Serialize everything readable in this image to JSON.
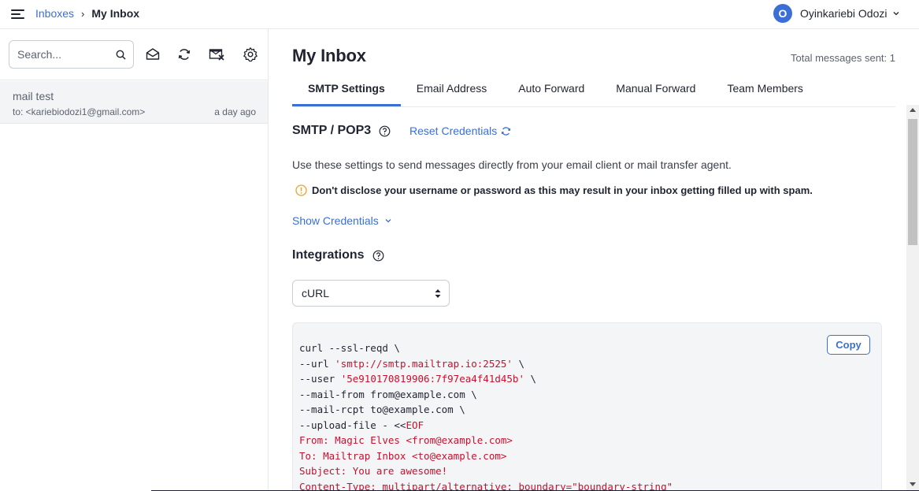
{
  "breadcrumb": {
    "parent": "Inboxes",
    "separator": "›",
    "current": "My Inbox"
  },
  "user": {
    "initial": "O",
    "name": "Oyinkariebi Odozi"
  },
  "sidebar": {
    "search_placeholder": "Search...",
    "toolbar_icons": [
      "mark-read-icon",
      "refresh-icon",
      "clear-inbox-icon",
      "settings-icon"
    ],
    "messages": [
      {
        "subject": "mail test",
        "to": "to: <kariebiodozi1@gmail.com>",
        "time": "a day ago"
      }
    ]
  },
  "main": {
    "title": "My Inbox",
    "total_sent": "Total messages sent: 1",
    "tabs": [
      {
        "label": "SMTP Settings",
        "active": true
      },
      {
        "label": "Email Address",
        "active": false
      },
      {
        "label": "Auto Forward",
        "active": false
      },
      {
        "label": "Manual Forward",
        "active": false
      },
      {
        "label": "Team Members",
        "active": false
      }
    ],
    "smtp": {
      "title": "SMTP / POP3",
      "reset_label": "Reset Credentials",
      "description": "Use these settings to send messages directly from your email client or mail transfer agent.",
      "warning": "Don't disclose your username or password as this may result in your inbox getting filled up with spam.",
      "show_credentials": "Show Credentials"
    },
    "integrations": {
      "title": "Integrations",
      "selected": "cURL",
      "copy_label": "Copy",
      "code_lines": [
        {
          "text": "curl --ssl-reqd \\",
          "str": "",
          "tail": ""
        },
        {
          "text": "--url ",
          "str": "'smtp://smtp.mailtrap.io:2525'",
          "tail": " \\"
        },
        {
          "text": "--user ",
          "str": "'5e910170819906:7f97ea4f41d45b'",
          "tail": " \\"
        },
        {
          "text": "--mail-from from@example.com \\",
          "str": "",
          "tail": ""
        },
        {
          "text": "--mail-rcpt to@example.com \\",
          "str": "",
          "tail": ""
        },
        {
          "text": "--upload-file - <<",
          "str": "EOF",
          "tail": ""
        },
        {
          "text": "",
          "str": "From: Magic Elves <from@example.com>",
          "tail": ""
        },
        {
          "text": "",
          "str": "To: Mailtrap Inbox <to@example.com>",
          "tail": ""
        },
        {
          "text": "",
          "str": "Subject: You are awesome!",
          "tail": ""
        },
        {
          "text": "",
          "str": "Content-Type: multipart/alternative; boundary=\"boundary-string\"",
          "tail": ""
        }
      ]
    }
  },
  "colors": {
    "accent": "#3b6fd6",
    "code_string": "#c8102e",
    "warning": "#f0a020"
  }
}
